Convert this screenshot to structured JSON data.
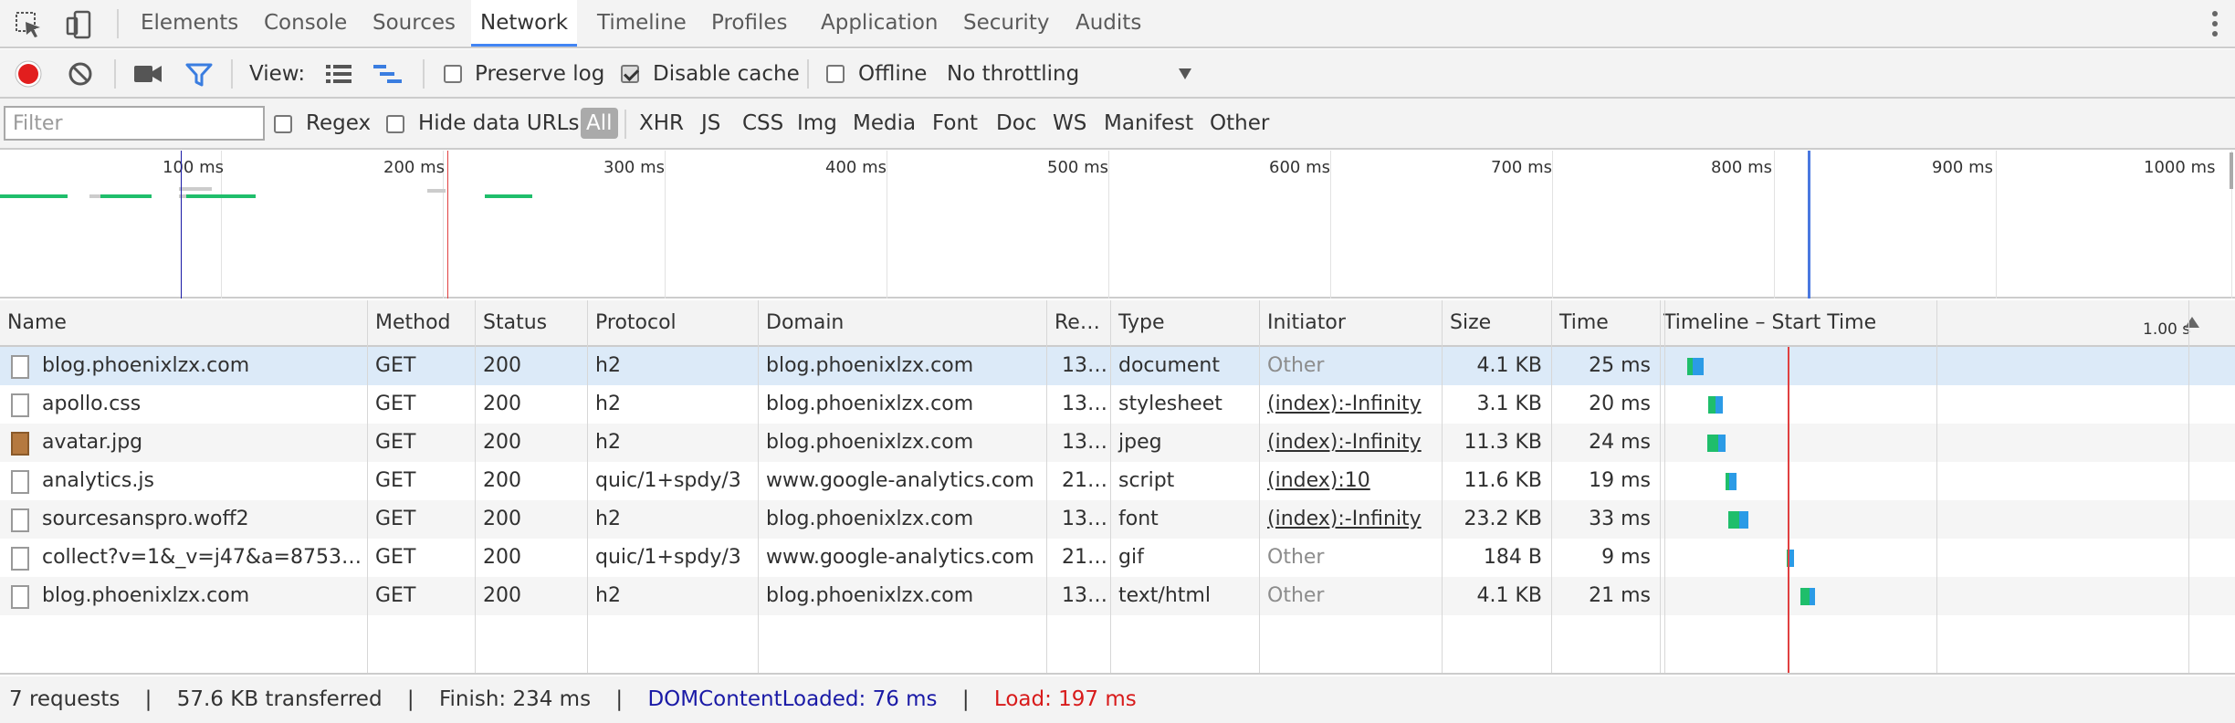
{
  "tabs": [
    "Elements",
    "Console",
    "Sources",
    "Network",
    "Timeline",
    "Profiles",
    "Application",
    "Security",
    "Audits"
  ],
  "active_tab": "Network",
  "toolbar": {
    "view_label": "View:",
    "preserve_log": "Preserve log",
    "preserve_log_checked": false,
    "disable_cache": "Disable cache",
    "disable_cache_checked": true,
    "offline": "Offline",
    "offline_checked": false,
    "throttling": "No throttling"
  },
  "filterbar": {
    "placeholder": "Filter",
    "regex": "Regex",
    "hide_data_urls": "Hide data URLs",
    "types": [
      "All",
      "XHR",
      "JS",
      "CSS",
      "Img",
      "Media",
      "Font",
      "Doc",
      "WS",
      "Manifest",
      "Other"
    ],
    "active_type": "All"
  },
  "overview": {
    "ticks": [
      "100 ms",
      "200 ms",
      "300 ms",
      "400 ms",
      "500 ms",
      "600 ms",
      "700 ms",
      "800 ms",
      "900 ms",
      "1000 ms"
    ]
  },
  "table": {
    "headers": {
      "name": "Name",
      "method": "Method",
      "status": "Status",
      "protocol": "Protocol",
      "domain": "Domain",
      "remote": "Re…",
      "type": "Type",
      "initiator": "Initiator",
      "size": "Size",
      "time": "Time",
      "timeline": "Timeline – Start Time",
      "timeline_scale": "1.00 s"
    },
    "rows": [
      {
        "name": "blog.phoenixlzx.com",
        "method": "GET",
        "status": "200",
        "protocol": "h2",
        "domain": "blog.phoenixlzx.com",
        "remote": "13…",
        "type": "document",
        "initiator": "Other",
        "size": "4.1 KB",
        "time": "25 ms"
      },
      {
        "name": "apollo.css",
        "method": "GET",
        "status": "200",
        "protocol": "h2",
        "domain": "blog.phoenixlzx.com",
        "remote": "13…",
        "type": "stylesheet",
        "initiator": "(index):-Infinity",
        "size": "3.1 KB",
        "time": "20 ms"
      },
      {
        "name": "avatar.jpg",
        "method": "GET",
        "status": "200",
        "protocol": "h2",
        "domain": "blog.phoenixlzx.com",
        "remote": "13…",
        "type": "jpeg",
        "initiator": "(index):-Infinity",
        "size": "11.3 KB",
        "time": "24 ms"
      },
      {
        "name": "analytics.js",
        "method": "GET",
        "status": "200",
        "protocol": "quic/1+spdy/3",
        "domain": "www.google-analytics.com",
        "remote": "21…",
        "type": "script",
        "initiator": "(index):10",
        "size": "11.6 KB",
        "time": "19 ms"
      },
      {
        "name": "sourcesanspro.woff2",
        "method": "GET",
        "status": "200",
        "protocol": "h2",
        "domain": "blog.phoenixlzx.com",
        "remote": "13…",
        "type": "font",
        "initiator": "(index):-Infinity",
        "size": "23.2 KB",
        "time": "33 ms"
      },
      {
        "name": "collect?v=1&_v=j47&a=8753347…",
        "method": "GET",
        "status": "200",
        "protocol": "quic/1+spdy/3",
        "domain": "www.google-analytics.com",
        "remote": "21…",
        "type": "gif",
        "initiator": "Other",
        "size": "184 B",
        "time": "9 ms"
      },
      {
        "name": "blog.phoenixlzx.com",
        "method": "GET",
        "status": "200",
        "protocol": "h2",
        "domain": "blog.phoenixlzx.com",
        "remote": "13…",
        "type": "text/html",
        "initiator": "Other",
        "size": "4.1 KB",
        "time": "21 ms"
      }
    ]
  },
  "statusbar": {
    "requests": "7 requests",
    "transferred": "57.6 KB transferred",
    "finish": "Finish: 234 ms",
    "dom_content_loaded": "DOMContentLoaded: 76 ms",
    "load": "Load: 197 ms",
    "sep": "|"
  },
  "colors": {
    "record": "#e21e1e",
    "dom_line": "#1a1aa6",
    "load_line": "#e04040",
    "selected_row": "#dceaf8",
    "dom_text": "#1a1aa6",
    "load_text": "#d81b1b"
  }
}
